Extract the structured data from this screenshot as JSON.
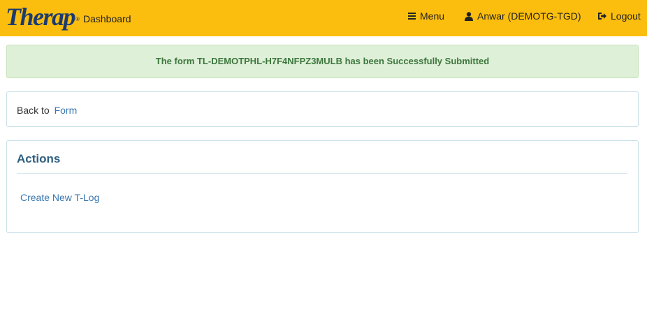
{
  "header": {
    "logo_text": "Therap",
    "logo_mark": "®",
    "dashboard_label": "Dashboard",
    "menu_label": "Menu",
    "user_label": "Anwar (DEMOTG-TGD)",
    "logout_label": "Logout",
    "bar_color": "#fcbe0e"
  },
  "alert": {
    "message": "The form TL-DEMOTPHL-H7F4NFPZ3MULB has been Successfully Submitted"
  },
  "back": {
    "prefix": "Back to",
    "link": "Form"
  },
  "actions": {
    "title": "Actions",
    "items": [
      {
        "label": "Create New T-Log"
      }
    ]
  },
  "icons": [
    "menu-icon",
    "user-icon",
    "logout-icon"
  ]
}
